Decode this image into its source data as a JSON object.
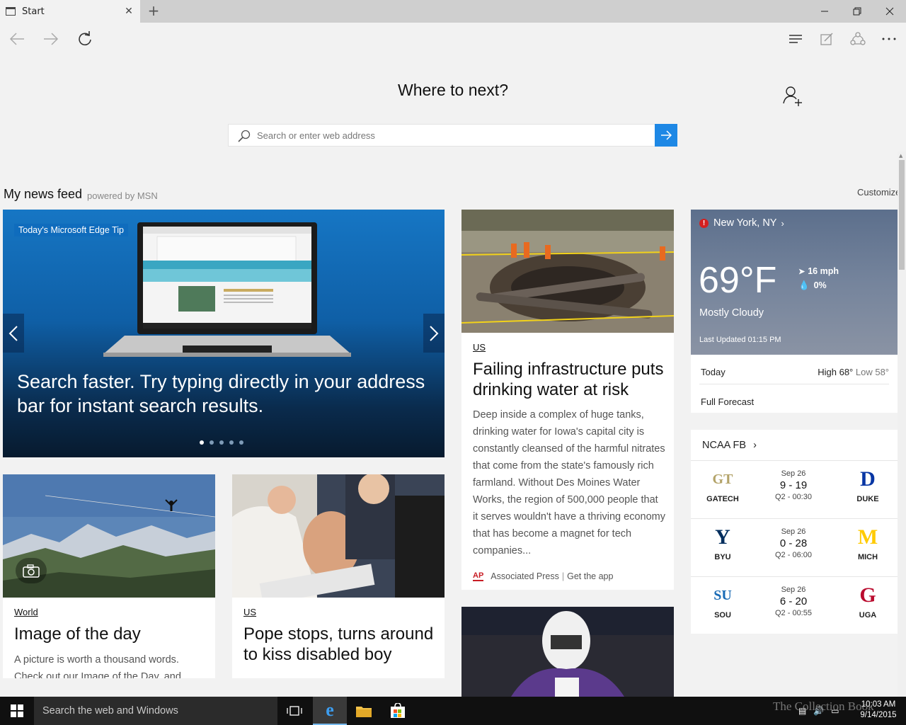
{
  "tab": {
    "title": "Start"
  },
  "start": {
    "heading": "Where to next?",
    "search_placeholder": "Search or enter web address"
  },
  "feed": {
    "title": "My news feed",
    "powered": "powered by MSN",
    "customize": "Customize"
  },
  "hero": {
    "tag": "Today's Microsoft Edge Tip",
    "text": "Search faster. Try typing directly in your address bar for instant search results.",
    "slide_count": 5,
    "active_slide": 1
  },
  "cards": {
    "infrastructure": {
      "category": "US",
      "headline": "Failing infrastructure puts drinking water at risk",
      "snippet": "Deep inside a complex of huge tanks, drinking water for Iowa's capital city is constantly cleansed of the harmful nitrates that come from the state's famously rich farmland. Without Des Moines Water Works, the region of 500,000 people that it serves wouldn't have a thriving economy that has become a magnet for tech companies...",
      "source": "Associated Press",
      "source_logo": "AP",
      "get_app": "Get the app"
    },
    "image_of_day": {
      "category": "World",
      "headline": "Image of the day",
      "snippet": "A picture is worth a thousand words. Check out our Image of the Day, and"
    },
    "pope": {
      "category": "US",
      "headline": "Pope stops, turns around to kiss disabled boy"
    }
  },
  "weather": {
    "location": "New York, NY",
    "temp": "69°F",
    "wind": "16 mph",
    "precip": "0%",
    "condition": "Mostly Cloudy",
    "updated": "Last Updated 01:15 PM",
    "today_label": "Today",
    "high": "High 68°",
    "low": "Low 58°",
    "forecast": "Full Forecast"
  },
  "ncaa": {
    "title": "NCAA FB",
    "games": [
      {
        "date": "Sep 26",
        "score": "9 - 19",
        "status": "Q2 - 00:30",
        "home": "GATECH",
        "away": "DUKE",
        "home_color": "#b3a369",
        "away_color": "#0736a4",
        "home_logo": "GT",
        "away_logo": "D"
      },
      {
        "date": "Sep 26",
        "score": "0 - 28",
        "status": "Q2 - 06:00",
        "home": "BYU",
        "away": "MICH",
        "home_color": "#002e5d",
        "away_color": "#ffcb05",
        "home_logo": "Y",
        "away_logo": "M"
      },
      {
        "date": "Sep 26",
        "score": "6 - 20",
        "status": "Q2 - 00:55",
        "home": "SOU",
        "away": "UGA",
        "home_color": "#1a6bb5",
        "away_color": "#ba0c2f",
        "home_logo": "SU",
        "away_logo": "G"
      }
    ]
  },
  "taskbar": {
    "search_placeholder": "Search the web and Windows",
    "time": "10:03 AM",
    "date": "9/14/2015"
  },
  "watermark": "The Collection Book"
}
